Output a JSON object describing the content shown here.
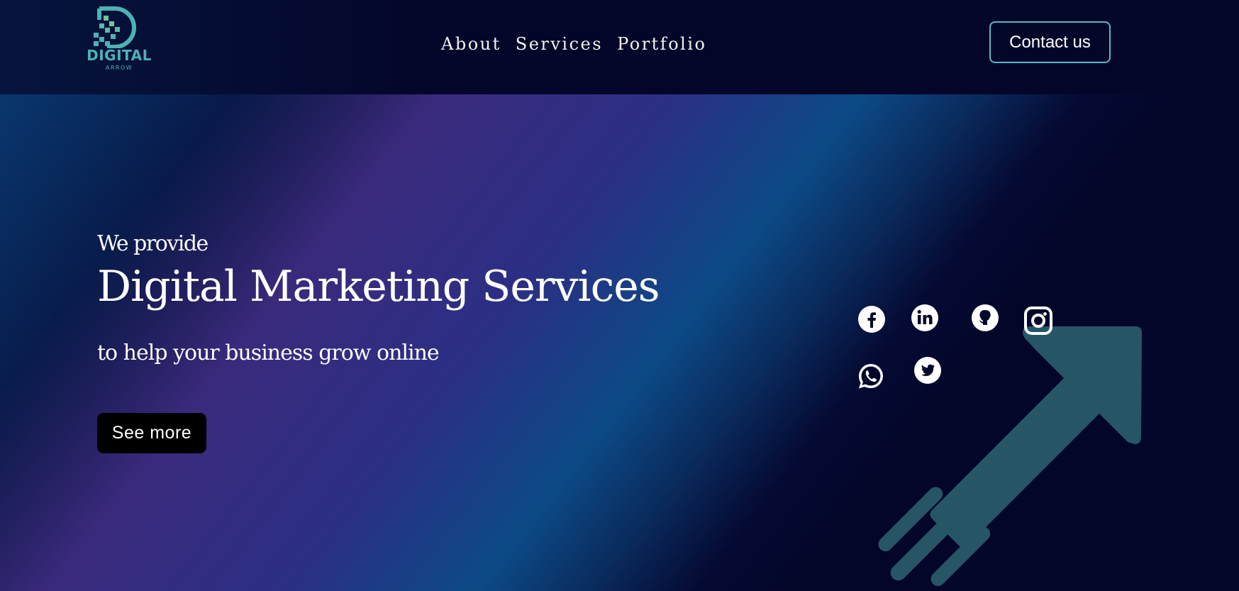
{
  "brand": {
    "name": "DIGITAL",
    "sub": "ARROW",
    "logo_color": "#4bb3b3"
  },
  "nav": {
    "items": [
      {
        "label": "About"
      },
      {
        "label": "Services"
      },
      {
        "label": "Portfolio"
      }
    ]
  },
  "header": {
    "contact_label": "Contact us",
    "contact_border_color": "#57b9c4"
  },
  "hero": {
    "pre_title": "We provide",
    "title": "Digital Marketing Services",
    "subtitle": "to help your business grow online",
    "cta_label": "See more"
  },
  "social": {
    "icons": [
      "facebook-icon",
      "linkedin-icon",
      "github-icon",
      "instagram-icon",
      "whatsapp-icon",
      "twitter-icon"
    ]
  },
  "colors": {
    "background": "#040629",
    "arrow": "#265566",
    "gradient_purple": "#3a2a7c",
    "gradient_blue": "#0c4a86"
  }
}
